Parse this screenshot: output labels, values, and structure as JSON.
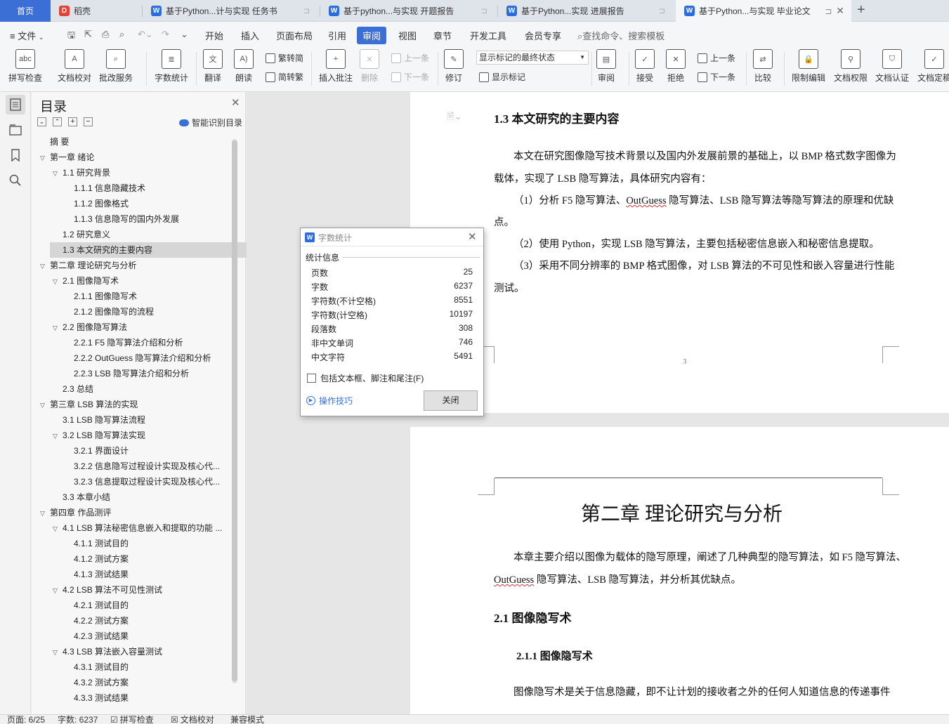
{
  "tabs": [
    {
      "label": "首页"
    },
    {
      "label": "稻壳"
    },
    {
      "label": "基于Python...计与实现 任务书"
    },
    {
      "label": "基于python...与实现 开题报告"
    },
    {
      "label": "基于Python...实现  进展报告"
    },
    {
      "label": "基于Python...与实现 毕业论文"
    }
  ],
  "menu": {
    "file": "文件",
    "items": [
      "开始",
      "插入",
      "页面布局",
      "引用",
      "审阅",
      "视图",
      "章节",
      "开发工具",
      "会员专享"
    ],
    "search": "查找命令、搜索模板"
  },
  "ribbon": {
    "spell": "拼写检查",
    "doc_check": "文档校对",
    "correction": "批改服务",
    "word_count": "字数统计",
    "translate": "翻译",
    "read": "朗读",
    "to_trad": "繁转简",
    "to_simp": "简转繁",
    "insert_comment": "插入批注",
    "delete": "删除",
    "prev": "上一条",
    "next": "下一条",
    "revise": "修订",
    "markup_state": "显示标记的最终状态",
    "show_markup": "显示标记",
    "review": "审阅",
    "accept": "接受",
    "reject": "拒绝",
    "prev2": "上一条",
    "next2": "下一条",
    "compare": "比较",
    "restrict": "限制编辑",
    "doc_perm": "文档权限",
    "doc_cert": "文档认证",
    "doc_final": "文档定稿"
  },
  "toc": {
    "title": "目录",
    "smart": "智能识别目录",
    "items": [
      {
        "label": "摘    要",
        "level": 0,
        "arrow": false
      },
      {
        "label": "第一章  绪论",
        "level": 0,
        "arrow": true
      },
      {
        "label": "1.1  研究背景",
        "level": 1,
        "arrow": true
      },
      {
        "label": "1.1.1  信息隐藏技术",
        "level": 2,
        "arrow": false
      },
      {
        "label": "1.1.2  图像格式",
        "level": 2,
        "arrow": false
      },
      {
        "label": "1.1.3  信息隐写的国内外发展",
        "level": 2,
        "arrow": false
      },
      {
        "label": "1.2  研究意义",
        "level": 1,
        "arrow": false
      },
      {
        "label": "1.3  本文研究的主要内容",
        "level": 1,
        "arrow": false,
        "selected": true
      },
      {
        "label": "第二章  理论研究与分析",
        "level": 0,
        "arrow": true
      },
      {
        "label": "2.1  图像隐写术",
        "level": 1,
        "arrow": true
      },
      {
        "label": "2.1.1  图像隐写术",
        "level": 2,
        "arrow": false
      },
      {
        "label": "2.1.2  图像隐写的流程",
        "level": 2,
        "arrow": false
      },
      {
        "label": "2.2 图像隐写算法",
        "level": 1,
        "arrow": true
      },
      {
        "label": "2.2.1 F5 隐写算法介绍和分析",
        "level": 2,
        "arrow": false
      },
      {
        "label": "2.2.2 OutGuess 隐写算法介绍和分析",
        "level": 2,
        "arrow": false
      },
      {
        "label": "2.2.3 LSB 隐写算法介绍和分析",
        "level": 2,
        "arrow": false
      },
      {
        "label": "2.3  总结",
        "level": 1,
        "arrow": false
      },
      {
        "label": "第三章  LSB 算法的实现",
        "level": 0,
        "arrow": true
      },
      {
        "label": "3.1 LSB 隐写算法流程",
        "level": 1,
        "arrow": false
      },
      {
        "label": "3.2 LSB 隐写算法实现",
        "level": 1,
        "arrow": true
      },
      {
        "label": "3.2.1  界面设计",
        "level": 2,
        "arrow": false
      },
      {
        "label": "3.2.2  信息隐写过程设计实现及核心代...",
        "level": 2,
        "arrow": false
      },
      {
        "label": "3.2.3  信息提取过程设计实现及核心代...",
        "level": 2,
        "arrow": false
      },
      {
        "label": "3.3 本章小结",
        "level": 1,
        "arrow": false
      },
      {
        "label": "第四章  作品测评",
        "level": 0,
        "arrow": true
      },
      {
        "label": "4.1 LSB 算法秘密信息嵌入和提取的功能 ...",
        "level": 1,
        "arrow": true
      },
      {
        "label": "4.1.1  测试目的",
        "level": 2,
        "arrow": false
      },
      {
        "label": "4.1.2  测试方案",
        "level": 2,
        "arrow": false
      },
      {
        "label": "4.1.3  测试结果",
        "level": 2,
        "arrow": false
      },
      {
        "label": "4.2 LSB 算法不可见性测试",
        "level": 1,
        "arrow": true
      },
      {
        "label": "4.2.1  测试目的",
        "level": 2,
        "arrow": false
      },
      {
        "label": "4.2.2  测试方案",
        "level": 2,
        "arrow": false
      },
      {
        "label": "4.2.3 测试结果",
        "level": 2,
        "arrow": false
      },
      {
        "label": "4.3 LSB 算法嵌入容量测试",
        "level": 1,
        "arrow": true
      },
      {
        "label": "4.3.1  测试目的",
        "level": 2,
        "arrow": false
      },
      {
        "label": "4.3.2  测试方案",
        "level": 2,
        "arrow": false
      },
      {
        "label": "4.3.3  测试结果",
        "level": 2,
        "arrow": false
      }
    ]
  },
  "doc": {
    "section_title": "1.3  本文研究的主要内容",
    "para1_a": "本文在研究图像隐写技术背景以及国内外发展前景的基础上，以 BMP 格式数字图像为",
    "para1_b": "载体，实现了 LSB 隐写算法，具体研究内容有：",
    "item1_pre": "（1）分析 F5 隐写算法、",
    "item1_word": "OutGuess",
    "item1_post": " 隐写算法、LSB 隐写算法等隐写算法的原理和优缺",
    "item1_b": "点。",
    "item2": "（2）使用 Python，实现 LSB 隐写算法，主要包括秘密信息嵌入和秘密信息提取。",
    "item3_a": "（3）采用不同分辨率的 BMP 格式图像，对 LSB 算法的不可见性和嵌入容量进行性能",
    "item3_b": "测试。",
    "page_number": "3",
    "chapter_title": "第二章  理论研究与分析",
    "ch_para_a": "本章主要介绍以图像为载体的隐写原理，阐述了几种典型的隐写算法，如 F5 隐写算法、",
    "ch_para_b_word": "OutGuess",
    "ch_para_b_post": " 隐写算法、LSB 隐写算法，并分析其优缺点。",
    "h21": "2.1  图像隐写术",
    "h211": "2.1.1  图像隐写术",
    "last_para": "图像隐写术是关于信息隐藏，即不让计划的接收者之外的任何人知道信息的传递事件"
  },
  "dialog": {
    "title": "字数统计",
    "section": "统计信息",
    "rows": [
      {
        "label": "页数",
        "value": "25"
      },
      {
        "label": "字数",
        "value": "6237"
      },
      {
        "label": "字符数(不计空格)",
        "value": "8551"
      },
      {
        "label": "字符数(计空格)",
        "value": "10197"
      },
      {
        "label": "段落数",
        "value": "308"
      },
      {
        "label": "非中文单词",
        "value": "746"
      },
      {
        "label": "中文字符",
        "value": "5491"
      }
    ],
    "checkbox": "包括文本框、脚注和尾注(F)",
    "tips": "操作技巧",
    "close": "关闭"
  },
  "status": {
    "page": "页面: 6/25",
    "words": "字数: 6237",
    "spell": "拼写检查",
    "doc_check": "文档校对",
    "compat": "兼容模式"
  },
  "colors": {
    "accent": "#3b6fd6",
    "tab_home": "#3b6fd6",
    "wps_blue": "#2b6de0",
    "docer_red": "#e0433a"
  }
}
